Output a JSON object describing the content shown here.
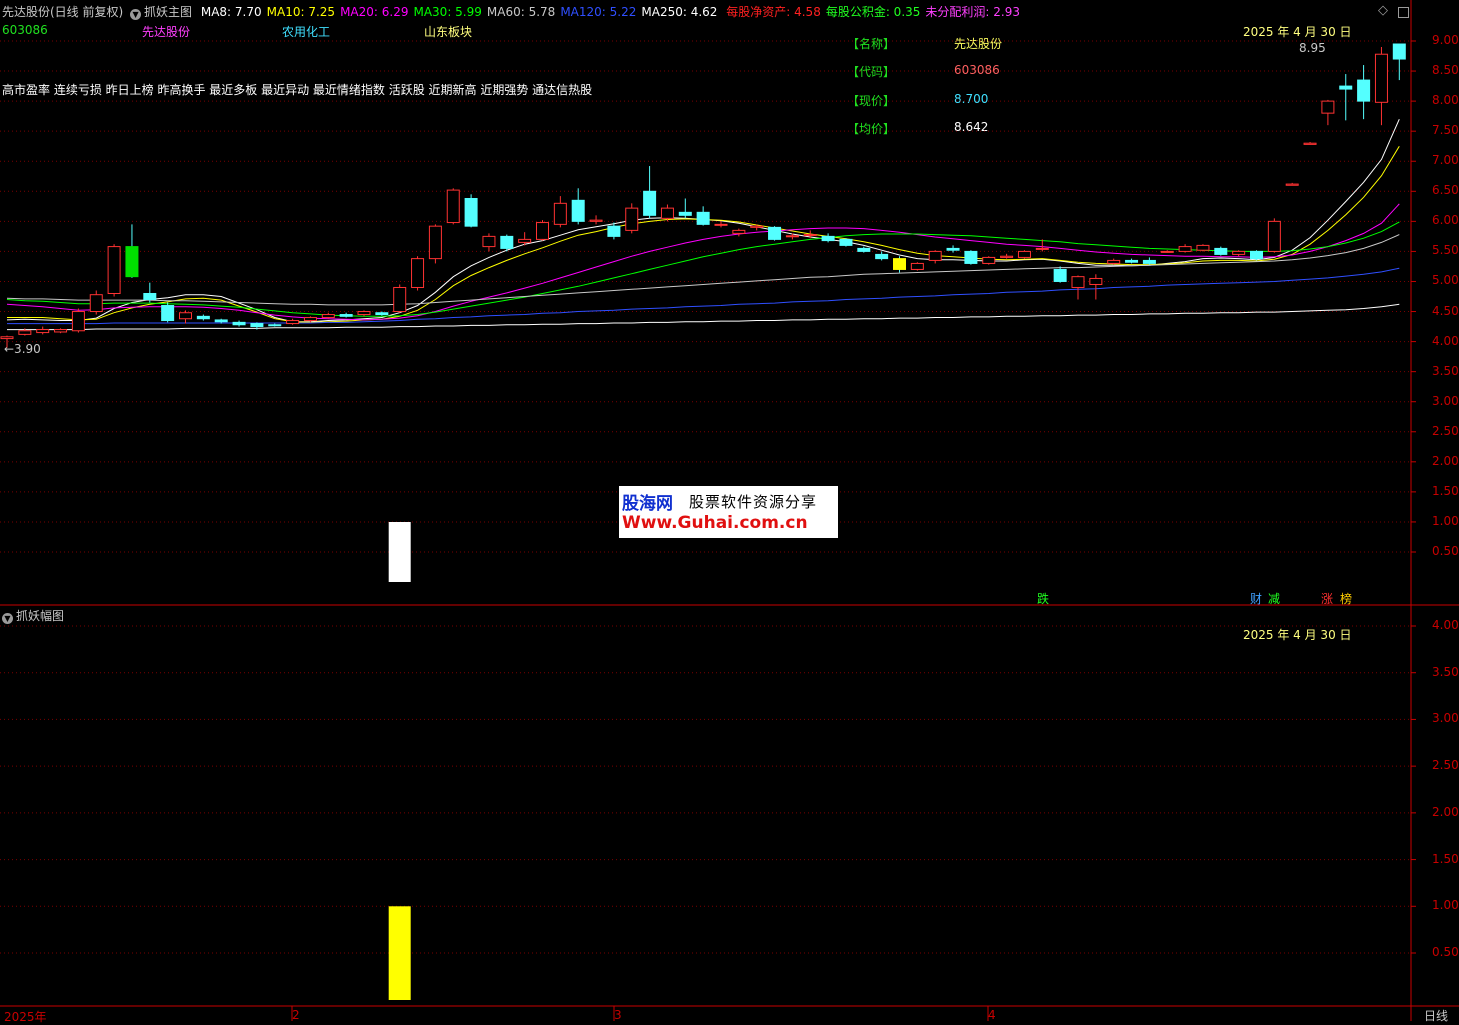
{
  "main_header": {
    "title": "先达股份(日线 前复权)",
    "indicator_name": "抓妖主图",
    "ma": [
      {
        "label": "MA8:",
        "value": "7.70",
        "color": "#ffffff"
      },
      {
        "label": "MA10:",
        "value": "7.25",
        "color": "#ffff00"
      },
      {
        "label": "MA20:",
        "value": "6.29",
        "color": "#ff00ff"
      },
      {
        "label": "MA30:",
        "value": "5.99",
        "color": "#00ff00"
      },
      {
        "label": "MA60:",
        "value": "5.78",
        "color": "#c8c8c8"
      },
      {
        "label": "MA120:",
        "value": "5.22",
        "color": "#2f4fff"
      },
      {
        "label": "MA250:",
        "value": "4.62",
        "color": "#ffffff"
      }
    ],
    "fin": [
      {
        "label": "每股净资产:",
        "value": "4.58",
        "color": "#ff2020"
      },
      {
        "label": "每股公积金:",
        "value": "0.35",
        "color": "#20ff20"
      },
      {
        "label": "未分配利润:",
        "value": "2.93",
        "color": "#ff40ff"
      }
    ]
  },
  "stock_line": {
    "code": "603086",
    "name": "先达股份",
    "industry": "农用化工",
    "region": "山东板块"
  },
  "tags_line": "高市盈率 连续亏损 昨日上榜 昨高换手 最近多板 最近异动 最近情绪指数 活跃股 近期新高 近期强势 通达信热股",
  "info_box": {
    "date": "2025 年 4 月 30 日",
    "rows": [
      {
        "label": "【名称】",
        "value": "先达股份",
        "color": "#ffff60"
      },
      {
        "label": "【代码】",
        "value": "603086",
        "color": "#ff6060"
      },
      {
        "label": "【现价】",
        "value": "8.700",
        "color": "#40e0ff"
      },
      {
        "label": "【均价】",
        "value": "8.642",
        "color": "#ffffff"
      }
    ]
  },
  "annotations": {
    "high": "8.95",
    "low": "←3.90"
  },
  "signals": [
    {
      "text": "跌",
      "color": "#20ff20"
    },
    {
      "text": "财",
      "color": "#40a0ff"
    },
    {
      "text": "减",
      "color": "#20ff20"
    },
    {
      "text": "涨",
      "color": "#ff3030"
    },
    {
      "text": "榜",
      "color": "#ffcc00"
    }
  ],
  "watermark": {
    "logo": "股海网",
    "slogan": "股票软件资源分享",
    "url": "Www.Guhai.com.cn"
  },
  "main_yaxis": [
    "9.00",
    "8.50",
    "8.00",
    "7.50",
    "7.00",
    "6.50",
    "6.00",
    "5.50",
    "5.00",
    "4.50",
    "4.00",
    "3.50",
    "3.00",
    "2.50",
    "2.00",
    "1.50",
    "1.00",
    "0.50"
  ],
  "sub_header": {
    "name": "抓妖幅图",
    "date": "2025 年 4 月 30 日"
  },
  "sub_yaxis": [
    "4.00",
    "3.50",
    "3.00",
    "2.50",
    "2.00",
    "1.50",
    "1.00",
    "0.50"
  ],
  "xaxis": [
    "2025年",
    "2",
    "3",
    "4"
  ],
  "period": "日线",
  "colors": {
    "up": "#ff3232",
    "down": "#54ffff",
    "grid": "#7a0000",
    "frame": "#c80000"
  },
  "chart_data": {
    "type": "candlestick",
    "ylim": [
      0.25,
      9.25
    ],
    "candles": [
      [
        4.05,
        4.08,
        3.9,
        4.1
      ],
      [
        4.12,
        4.18,
        4.1,
        4.22
      ],
      [
        4.15,
        4.2,
        4.12,
        4.25
      ],
      [
        4.16,
        4.2,
        4.14,
        4.22
      ],
      [
        4.18,
        4.5,
        4.15,
        4.55
      ],
      [
        4.5,
        4.78,
        4.45,
        4.85
      ],
      [
        4.8,
        5.58,
        4.75,
        5.62
      ],
      [
        5.58,
        5.08,
        5.06,
        5.95
      ],
      [
        4.8,
        4.7,
        4.65,
        4.98
      ],
      [
        4.6,
        4.35,
        4.32,
        4.65
      ],
      [
        4.38,
        4.48,
        4.3,
        4.52
      ],
      [
        4.42,
        4.38,
        4.35,
        4.45
      ],
      [
        4.36,
        4.33,
        4.3,
        4.38
      ],
      [
        4.32,
        4.28,
        4.25,
        4.35
      ],
      [
        4.3,
        4.25,
        4.2,
        4.32
      ],
      [
        4.28,
        4.27,
        4.25,
        4.3
      ],
      [
        4.3,
        4.35,
        4.28,
        4.38
      ],
      [
        4.35,
        4.4,
        4.32,
        4.42
      ],
      [
        4.4,
        4.45,
        4.38,
        4.48
      ],
      [
        4.45,
        4.42,
        4.4,
        4.48
      ],
      [
        4.45,
        4.5,
        4.42,
        4.52
      ],
      [
        4.48,
        4.45,
        4.43,
        4.5
      ],
      [
        4.5,
        4.9,
        4.48,
        4.95
      ],
      [
        4.9,
        5.38,
        4.85,
        5.42
      ],
      [
        5.38,
        5.92,
        5.3,
        5.95
      ],
      [
        5.98,
        6.52,
        5.95,
        6.55
      ],
      [
        6.38,
        5.92,
        5.9,
        6.45
      ],
      [
        5.58,
        5.75,
        5.5,
        5.8
      ],
      [
        5.75,
        5.55,
        5.5,
        5.78
      ],
      [
        5.65,
        5.7,
        5.6,
        5.82
      ],
      [
        5.7,
        5.98,
        5.68,
        6.02
      ],
      [
        5.95,
        6.3,
        5.9,
        6.42
      ],
      [
        6.35,
        6.0,
        5.95,
        6.55
      ],
      [
        6.0,
        6.02,
        5.95,
        6.1
      ],
      [
        5.92,
        5.75,
        5.7,
        5.98
      ],
      [
        5.85,
        6.22,
        5.8,
        6.3
      ],
      [
        6.5,
        6.1,
        6.05,
        6.92
      ],
      [
        6.05,
        6.22,
        6.0,
        6.28
      ],
      [
        6.15,
        6.1,
        6.05,
        6.38
      ],
      [
        6.15,
        5.95,
        5.93,
        6.25
      ],
      [
        5.95,
        5.95,
        5.9,
        6.0
      ],
      [
        5.8,
        5.85,
        5.75,
        5.88
      ],
      [
        5.9,
        5.92,
        5.85,
        5.95
      ],
      [
        5.9,
        5.7,
        5.68,
        5.92
      ],
      [
        5.75,
        5.76,
        5.7,
        5.8
      ],
      [
        5.78,
        5.78,
        5.72,
        5.85
      ],
      [
        5.75,
        5.68,
        5.65,
        5.8
      ],
      [
        5.7,
        5.6,
        5.58,
        5.72
      ],
      [
        5.55,
        5.5,
        5.48,
        5.58
      ],
      [
        5.45,
        5.38,
        5.35,
        5.5
      ],
      [
        5.38,
        5.2,
        5.15,
        5.42
      ],
      [
        5.2,
        5.3,
        5.18,
        5.32
      ],
      [
        5.35,
        5.5,
        5.3,
        5.52
      ],
      [
        5.55,
        5.52,
        5.48,
        5.6
      ],
      [
        5.5,
        5.3,
        5.28,
        5.52
      ],
      [
        5.3,
        5.4,
        5.28,
        5.42
      ],
      [
        5.4,
        5.42,
        5.38,
        5.46
      ],
      [
        5.4,
        5.5,
        5.38,
        5.52
      ],
      [
        5.55,
        5.55,
        5.5,
        5.7
      ],
      [
        5.2,
        5.0,
        4.98,
        5.25
      ],
      [
        4.9,
        5.08,
        4.7,
        5.1
      ],
      [
        4.95,
        5.05,
        4.7,
        5.12
      ],
      [
        5.3,
        5.35,
        5.28,
        5.38
      ],
      [
        5.35,
        5.32,
        5.3,
        5.38
      ],
      [
        5.35,
        5.3,
        5.28,
        5.4
      ],
      [
        5.5,
        5.5,
        5.48,
        5.52
      ],
      [
        5.5,
        5.58,
        5.48,
        5.62
      ],
      [
        5.52,
        5.6,
        5.5,
        5.62
      ],
      [
        5.55,
        5.45,
        5.43,
        5.58
      ],
      [
        5.45,
        5.5,
        5.42,
        5.52
      ],
      [
        5.5,
        5.38,
        5.35,
        5.52
      ],
      [
        5.5,
        6.0,
        5.48,
        6.05
      ],
      [
        6.6,
        6.62,
        6.6,
        6.64
      ],
      [
        7.28,
        7.3,
        7.28,
        7.32
      ],
      [
        7.8,
        8.0,
        7.6,
        8.02
      ],
      [
        8.25,
        8.2,
        7.68,
        8.45
      ],
      [
        8.35,
        8.0,
        7.7,
        8.6
      ],
      [
        7.98,
        8.78,
        7.6,
        8.9
      ],
      [
        8.95,
        8.7,
        8.35,
        8.95
      ]
    ],
    "ma": [
      {
        "name": "MA8",
        "color": "#ffffff",
        "values": [
          4.36,
          4.37,
          4.36,
          4.35,
          4.35,
          4.39,
          4.55,
          4.65,
          4.7,
          4.73,
          4.78,
          4.78,
          4.75,
          4.64,
          4.53,
          4.4,
          4.33,
          4.33,
          4.35,
          4.36,
          4.38,
          4.4,
          4.48,
          4.6,
          4.82,
          5.08,
          5.26,
          5.4,
          5.52,
          5.62,
          5.68,
          5.77,
          5.86,
          5.91,
          5.96,
          6.02,
          6.05,
          6.06,
          6.05,
          6.03,
          6.01,
          5.97,
          5.91,
          5.85,
          5.79,
          5.74,
          5.7,
          5.66,
          5.6,
          5.52,
          5.44,
          5.38,
          5.36,
          5.36,
          5.35,
          5.34,
          5.34,
          5.36,
          5.37,
          5.34,
          5.3,
          5.27,
          5.27,
          5.26,
          5.27,
          5.3,
          5.33,
          5.38,
          5.39,
          5.38,
          5.36,
          5.4,
          5.52,
          5.73,
          6.02,
          6.33,
          6.65,
          7.03,
          7.7
        ]
      },
      {
        "name": "MA10",
        "color": "#ffff00",
        "values": [
          4.4,
          4.4,
          4.4,
          4.38,
          4.36,
          4.37,
          4.48,
          4.56,
          4.62,
          4.66,
          4.71,
          4.72,
          4.69,
          4.59,
          4.49,
          4.38,
          4.33,
          4.32,
          4.33,
          4.34,
          4.36,
          4.37,
          4.42,
          4.52,
          4.7,
          4.93,
          5.1,
          5.23,
          5.35,
          5.46,
          5.56,
          5.67,
          5.77,
          5.83,
          5.9,
          5.96,
          6.0,
          6.03,
          6.04,
          6.03,
          6.02,
          5.99,
          5.94,
          5.89,
          5.84,
          5.79,
          5.75,
          5.71,
          5.66,
          5.6,
          5.53,
          5.47,
          5.43,
          5.41,
          5.39,
          5.37,
          5.36,
          5.37,
          5.38,
          5.35,
          5.32,
          5.3,
          5.29,
          5.28,
          5.28,
          5.29,
          5.31,
          5.34,
          5.35,
          5.35,
          5.34,
          5.37,
          5.45,
          5.62,
          5.85,
          6.11,
          6.4,
          6.76,
          7.25
        ]
      },
      {
        "name": "MA20",
        "color": "#ff00ff",
        "values": [
          4.62,
          4.6,
          4.58,
          4.55,
          4.52,
          4.53,
          4.56,
          4.57,
          4.58,
          4.58,
          4.58,
          4.57,
          4.55,
          4.52,
          4.48,
          4.44,
          4.41,
          4.39,
          4.38,
          4.37,
          4.36,
          4.37,
          4.39,
          4.43,
          4.5,
          4.59,
          4.67,
          4.74,
          4.81,
          4.89,
          4.97,
          5.06,
          5.15,
          5.24,
          5.33,
          5.42,
          5.5,
          5.57,
          5.64,
          5.7,
          5.75,
          5.79,
          5.82,
          5.84,
          5.86,
          5.88,
          5.89,
          5.89,
          5.88,
          5.85,
          5.82,
          5.78,
          5.74,
          5.71,
          5.68,
          5.65,
          5.62,
          5.6,
          5.58,
          5.55,
          5.52,
          5.49,
          5.47,
          5.45,
          5.44,
          5.43,
          5.42,
          5.42,
          5.41,
          5.41,
          5.4,
          5.41,
          5.44,
          5.5,
          5.58,
          5.68,
          5.8,
          5.97,
          6.29
        ]
      },
      {
        "name": "MA30",
        "color": "#00ff00",
        "values": [
          4.7,
          4.68,
          4.67,
          4.65,
          4.63,
          4.63,
          4.64,
          4.64,
          4.64,
          4.63,
          4.62,
          4.61,
          4.59,
          4.57,
          4.54,
          4.51,
          4.48,
          4.46,
          4.44,
          4.43,
          4.42,
          4.42,
          4.43,
          4.45,
          4.49,
          4.54,
          4.59,
          4.64,
          4.69,
          4.74,
          4.8,
          4.86,
          4.92,
          4.99,
          5.06,
          5.13,
          5.2,
          5.27,
          5.34,
          5.41,
          5.47,
          5.53,
          5.58,
          5.62,
          5.66,
          5.7,
          5.73,
          5.76,
          5.78,
          5.79,
          5.79,
          5.79,
          5.78,
          5.77,
          5.76,
          5.74,
          5.72,
          5.7,
          5.68,
          5.66,
          5.63,
          5.61,
          5.59,
          5.57,
          5.55,
          5.54,
          5.53,
          5.52,
          5.51,
          5.5,
          5.5,
          5.5,
          5.51,
          5.54,
          5.58,
          5.64,
          5.72,
          5.83,
          5.99
        ]
      },
      {
        "name": "MA60",
        "color": "#c8c8c8",
        "values": [
          4.72,
          4.71,
          4.71,
          4.7,
          4.69,
          4.69,
          4.69,
          4.69,
          4.69,
          4.68,
          4.68,
          4.67,
          4.66,
          4.65,
          4.64,
          4.63,
          4.62,
          4.62,
          4.61,
          4.61,
          4.61,
          4.61,
          4.62,
          4.63,
          4.65,
          4.67,
          4.69,
          4.71,
          4.73,
          4.75,
          4.77,
          4.79,
          4.81,
          4.83,
          4.85,
          4.87,
          4.89,
          4.91,
          4.93,
          4.95,
          4.97,
          4.99,
          5.01,
          5.03,
          5.05,
          5.07,
          5.08,
          5.1,
          5.12,
          5.13,
          5.14,
          5.15,
          5.16,
          5.17,
          5.18,
          5.19,
          5.2,
          5.21,
          5.22,
          5.23,
          5.23,
          5.24,
          5.25,
          5.26,
          5.27,
          5.28,
          5.29,
          5.3,
          5.31,
          5.32,
          5.33,
          5.34,
          5.36,
          5.39,
          5.43,
          5.48,
          5.55,
          5.65,
          5.78
        ]
      },
      {
        "name": "MA120",
        "color": "#2f4fff",
        "values": [
          4.3,
          4.3,
          4.3,
          4.3,
          4.3,
          4.3,
          4.31,
          4.31,
          4.31,
          4.31,
          4.31,
          4.31,
          4.31,
          4.31,
          4.31,
          4.31,
          4.31,
          4.31,
          4.32,
          4.32,
          4.33,
          4.34,
          4.35,
          4.37,
          4.38,
          4.4,
          4.41,
          4.43,
          4.44,
          4.45,
          4.47,
          4.48,
          4.5,
          4.51,
          4.52,
          4.54,
          4.55,
          4.56,
          4.58,
          4.59,
          4.6,
          4.62,
          4.63,
          4.64,
          4.66,
          4.67,
          4.68,
          4.7,
          4.71,
          4.72,
          4.74,
          4.75,
          4.76,
          4.78,
          4.79,
          4.8,
          4.82,
          4.83,
          4.84,
          4.86,
          4.87,
          4.88,
          4.9,
          4.91,
          4.92,
          4.94,
          4.95,
          4.96,
          4.97,
          4.98,
          4.99,
          5.0,
          5.02,
          5.04,
          5.06,
          5.09,
          5.12,
          5.16,
          5.22
        ]
      },
      {
        "name": "MA250",
        "color": "#ffffff",
        "values": [
          4.2,
          4.2,
          4.2,
          4.2,
          4.2,
          4.21,
          4.21,
          4.21,
          4.21,
          4.21,
          4.22,
          4.22,
          4.22,
          4.22,
          4.22,
          4.23,
          4.23,
          4.23,
          4.23,
          4.24,
          4.24,
          4.24,
          4.25,
          4.25,
          4.26,
          4.26,
          4.27,
          4.27,
          4.28,
          4.28,
          4.29,
          4.29,
          4.3,
          4.3,
          4.31,
          4.31,
          4.32,
          4.32,
          4.33,
          4.33,
          4.34,
          4.34,
          4.35,
          4.35,
          4.36,
          4.36,
          4.37,
          4.37,
          4.38,
          4.38,
          4.39,
          4.39,
          4.4,
          4.4,
          4.41,
          4.41,
          4.42,
          4.42,
          4.43,
          4.43,
          4.44,
          4.44,
          4.45,
          4.45,
          4.46,
          4.46,
          4.47,
          4.47,
          4.48,
          4.48,
          4.49,
          4.49,
          4.5,
          4.51,
          4.52,
          4.53,
          4.55,
          4.58,
          4.62
        ]
      }
    ],
    "main_bar": {
      "index": 22,
      "value": 1.0,
      "color": "#ffffff"
    },
    "sub_bar": {
      "index": 22,
      "value": 1.0,
      "color": "#ffff00"
    },
    "sub_ylim": [
      0,
      4.25
    ]
  }
}
